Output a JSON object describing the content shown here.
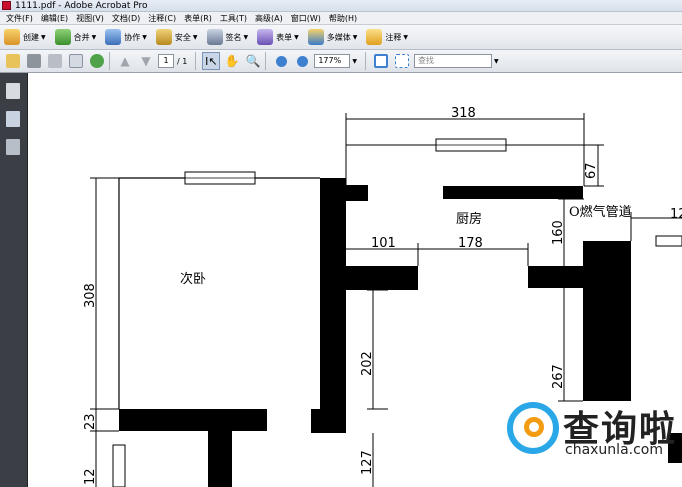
{
  "window": {
    "title": "1111.pdf - Adobe Acrobat Pro"
  },
  "menu": [
    "文件(F)",
    "编辑(E)",
    "视图(V)",
    "文档(D)",
    "注释(C)",
    "表单(R)",
    "工具(T)",
    "高级(A)",
    "窗口(W)",
    "帮助(H)"
  ],
  "toolbar": {
    "create": "创建",
    "combine": "合并",
    "collaborate": "协作",
    "secure": "安全",
    "sign": "签名",
    "forms": "表单",
    "multimedia": "多媒体",
    "comment": "注释"
  },
  "nav": {
    "page_current": "1",
    "page_total": "/ 1",
    "zoom": "177%",
    "find_placeholder": "查找"
  },
  "drawing": {
    "dims": {
      "d318_top": "318",
      "d67": "67",
      "d101": "101",
      "d178": "178",
      "d160": "160",
      "d308": "308",
      "d202": "202",
      "d267": "267",
      "d23": "23",
      "d127": "127",
      "d12_bottom": "12",
      "d12_right": "12"
    },
    "labels": {
      "kitchen": "厨房",
      "bedroom": "次卧",
      "gas_pipe": "O燃气管道"
    }
  },
  "watermark": {
    "cn": "查询啦",
    "en": "chaxunla.com"
  },
  "colors": {
    "accent_blue": "#2aa7e6",
    "accent_orange": "#f39c12",
    "sidebar": "#3b3e44"
  }
}
